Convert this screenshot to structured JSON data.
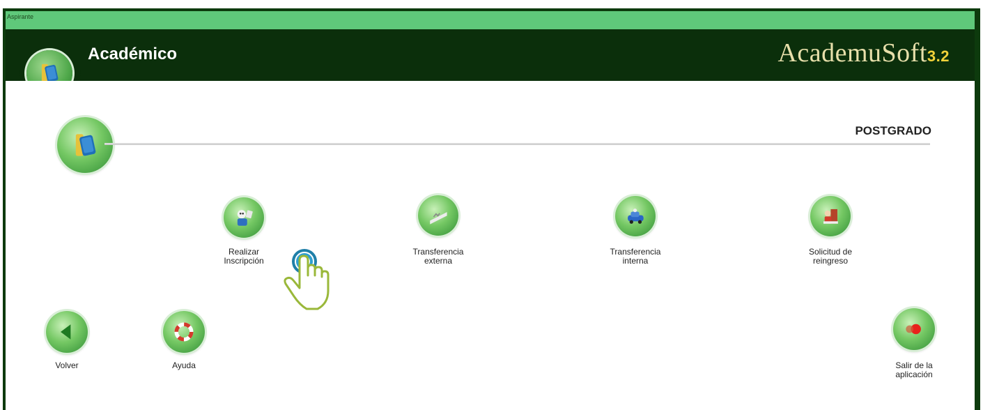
{
  "window": {
    "user_label": "Aspirante"
  },
  "header": {
    "title": "Académico",
    "brand": "AcademuSoft",
    "brand_version": "3.2"
  },
  "section": {
    "title": "POSTGRADO"
  },
  "menu": [
    {
      "line1": "Realizar",
      "line2": "Inscripción",
      "icon": "registration-icon"
    },
    {
      "line1": "Transferencia",
      "line2": "externa",
      "icon": "external-transfer-icon"
    },
    {
      "line1": "Transferencia",
      "line2": "interna",
      "icon": "internal-transfer-icon"
    },
    {
      "line1": "Solicitud de",
      "line2": "reingreso",
      "icon": "reentry-request-icon"
    }
  ],
  "nav": {
    "back": "Volver",
    "help": "Ayuda",
    "exit_line1": "Salir de la",
    "exit_line2": "aplicación"
  },
  "colors": {
    "header_bg": "#0b2f0b",
    "top_strip": "#5fc87a",
    "brand_text": "#e7dfaa",
    "brand_version": "#f2d23a",
    "cursor_stroke": "#9ab83a",
    "cursor_ripple": "#1f7fa8"
  }
}
